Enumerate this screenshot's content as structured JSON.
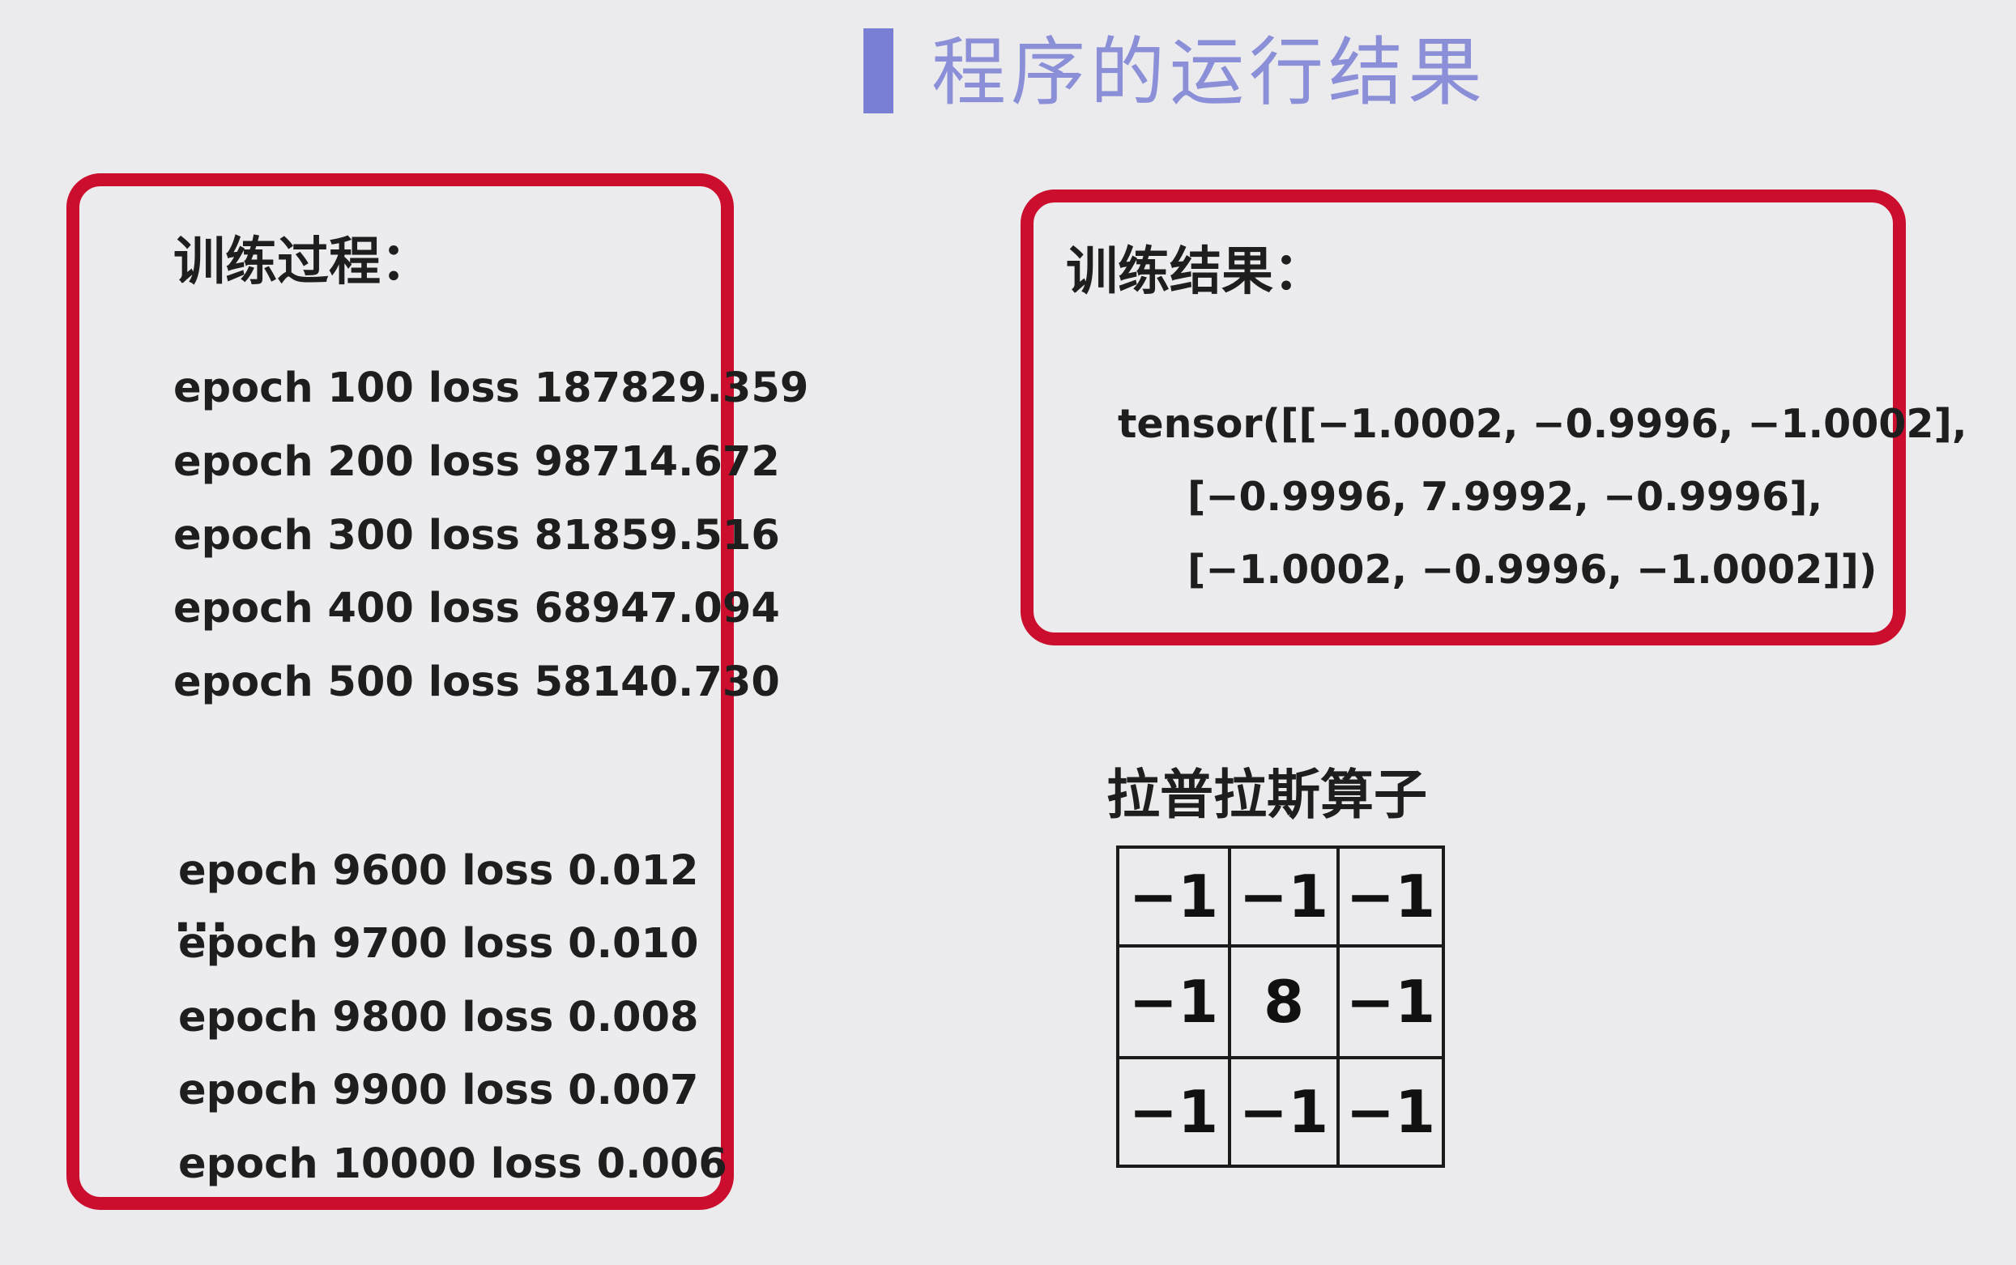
{
  "title": "程序的运行结果",
  "training_process": {
    "heading": "训练过程：",
    "lines_top": [
      "epoch 100 loss 187829.359",
      "epoch 200 loss 98714.672",
      "epoch 300 loss 81859.516",
      "epoch 400 loss 68947.094",
      "epoch 500 loss 58140.730"
    ],
    "ellipsis": "...",
    "lines_bottom": [
      "epoch 9600 loss 0.012",
      "epoch 9700 loss 0.010",
      "epoch 9800 loss 0.008",
      "epoch 9900 loss 0.007",
      "epoch 10000 loss 0.006"
    ]
  },
  "training_result": {
    "heading": "训练结果：",
    "tensor_lines": [
      "tensor([[−1.0002, −0.9996, −1.0002],",
      "[−0.9996,  7.9992, −0.9996],",
      "[−1.0002, −0.9996, −1.0002]])"
    ]
  },
  "laplacian": {
    "heading": "拉普拉斯算子",
    "matrix": [
      [
        "−1",
        "−1",
        "−1"
      ],
      [
        "−1",
        "8",
        "−1"
      ],
      [
        "−1",
        "−1",
        "−1"
      ]
    ]
  },
  "colors": {
    "panel_border": "#cc0e2e",
    "title_accent": "#7a7fd6",
    "title_text": "#8b8fd8",
    "background": "#ebebed"
  }
}
